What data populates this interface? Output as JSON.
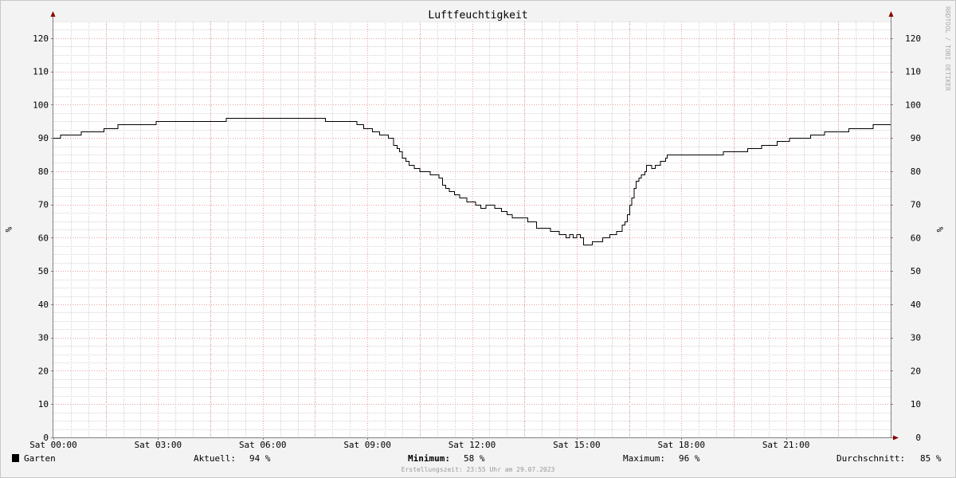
{
  "chart_data": {
    "type": "line",
    "title": "Luftfeuchtigkeit",
    "ylabel": "%",
    "ylim": [
      0,
      125
    ],
    "y_ticks": [
      0,
      10,
      20,
      30,
      40,
      50,
      60,
      70,
      80,
      90,
      100,
      110,
      120
    ],
    "x_range_hours": [
      0,
      24
    ],
    "x_ticks": [
      {
        "hour": 0,
        "label": "Sat 00:00"
      },
      {
        "hour": 3,
        "label": "Sat 03:00"
      },
      {
        "hour": 6,
        "label": "Sat 06:00"
      },
      {
        "hour": 9,
        "label": "Sat 09:00"
      },
      {
        "hour": 12,
        "label": "Sat 12:00"
      },
      {
        "hour": 15,
        "label": "Sat 15:00"
      },
      {
        "hour": 18,
        "label": "Sat 18:00"
      },
      {
        "hour": 21,
        "label": "Sat 21:00"
      }
    ],
    "grid": true,
    "series": [
      {
        "name": "Garten",
        "color": "#000000",
        "step": true,
        "points": [
          [
            0.0,
            90
          ],
          [
            0.2,
            91
          ],
          [
            0.8,
            92
          ],
          [
            1.45,
            93
          ],
          [
            1.85,
            94
          ],
          [
            2.95,
            95
          ],
          [
            4.95,
            96
          ],
          [
            7.8,
            95
          ],
          [
            8.7,
            94
          ],
          [
            8.9,
            93
          ],
          [
            9.15,
            92
          ],
          [
            9.35,
            91
          ],
          [
            9.6,
            90
          ],
          [
            9.75,
            88
          ],
          [
            9.85,
            87
          ],
          [
            9.92,
            86
          ],
          [
            10.0,
            84
          ],
          [
            10.1,
            83
          ],
          [
            10.2,
            82
          ],
          [
            10.35,
            81
          ],
          [
            10.5,
            80
          ],
          [
            10.8,
            79
          ],
          [
            11.05,
            78
          ],
          [
            11.15,
            76
          ],
          [
            11.25,
            75
          ],
          [
            11.35,
            74
          ],
          [
            11.5,
            73
          ],
          [
            11.65,
            72
          ],
          [
            11.85,
            71
          ],
          [
            12.1,
            70
          ],
          [
            12.25,
            69
          ],
          [
            12.4,
            70
          ],
          [
            12.65,
            69
          ],
          [
            12.85,
            68
          ],
          [
            13.0,
            67
          ],
          [
            13.15,
            66
          ],
          [
            13.6,
            65
          ],
          [
            13.85,
            63
          ],
          [
            14.25,
            62
          ],
          [
            14.5,
            61
          ],
          [
            14.7,
            60
          ],
          [
            14.8,
            61
          ],
          [
            14.9,
            60
          ],
          [
            15.0,
            61
          ],
          [
            15.1,
            60
          ],
          [
            15.2,
            58
          ],
          [
            15.45,
            59
          ],
          [
            15.75,
            60
          ],
          [
            15.95,
            61
          ],
          [
            16.15,
            62
          ],
          [
            16.3,
            64
          ],
          [
            16.38,
            65
          ],
          [
            16.45,
            67
          ],
          [
            16.52,
            70
          ],
          [
            16.58,
            72
          ],
          [
            16.65,
            75
          ],
          [
            16.7,
            77
          ],
          [
            16.78,
            78
          ],
          [
            16.85,
            79
          ],
          [
            16.95,
            80
          ],
          [
            17.0,
            82
          ],
          [
            17.15,
            81
          ],
          [
            17.25,
            82
          ],
          [
            17.4,
            83
          ],
          [
            17.55,
            84
          ],
          [
            17.6,
            85
          ],
          [
            19.2,
            86
          ],
          [
            19.9,
            87
          ],
          [
            20.3,
            88
          ],
          [
            20.75,
            89
          ],
          [
            21.1,
            90
          ],
          [
            21.7,
            91
          ],
          [
            22.1,
            92
          ],
          [
            22.8,
            93
          ],
          [
            23.5,
            94
          ],
          [
            24.0,
            94
          ]
        ]
      }
    ]
  },
  "legend": {
    "series_name": "Garten",
    "series_color": "#000000",
    "current_label": "Aktuell:",
    "current_value": "94 %",
    "min_label": "Minimum:",
    "min_value": "58 %",
    "max_label": "Maximum:",
    "max_value": "96 %",
    "avg_label": "Durchschnitt:",
    "avg_value": "85 %"
  },
  "footer": "Erstellungszeit: 23:55 Uhr am 29.07.2023",
  "watermark": "RRDTOOL / TOBI OETIKER",
  "colors": {
    "background": "#f3f3f3",
    "plot_background": "#ffffff",
    "major_grid": "#e8a0a0",
    "minor_grid": "#d4d4d4",
    "axis": "#808080",
    "arrow": "#8b0000"
  }
}
